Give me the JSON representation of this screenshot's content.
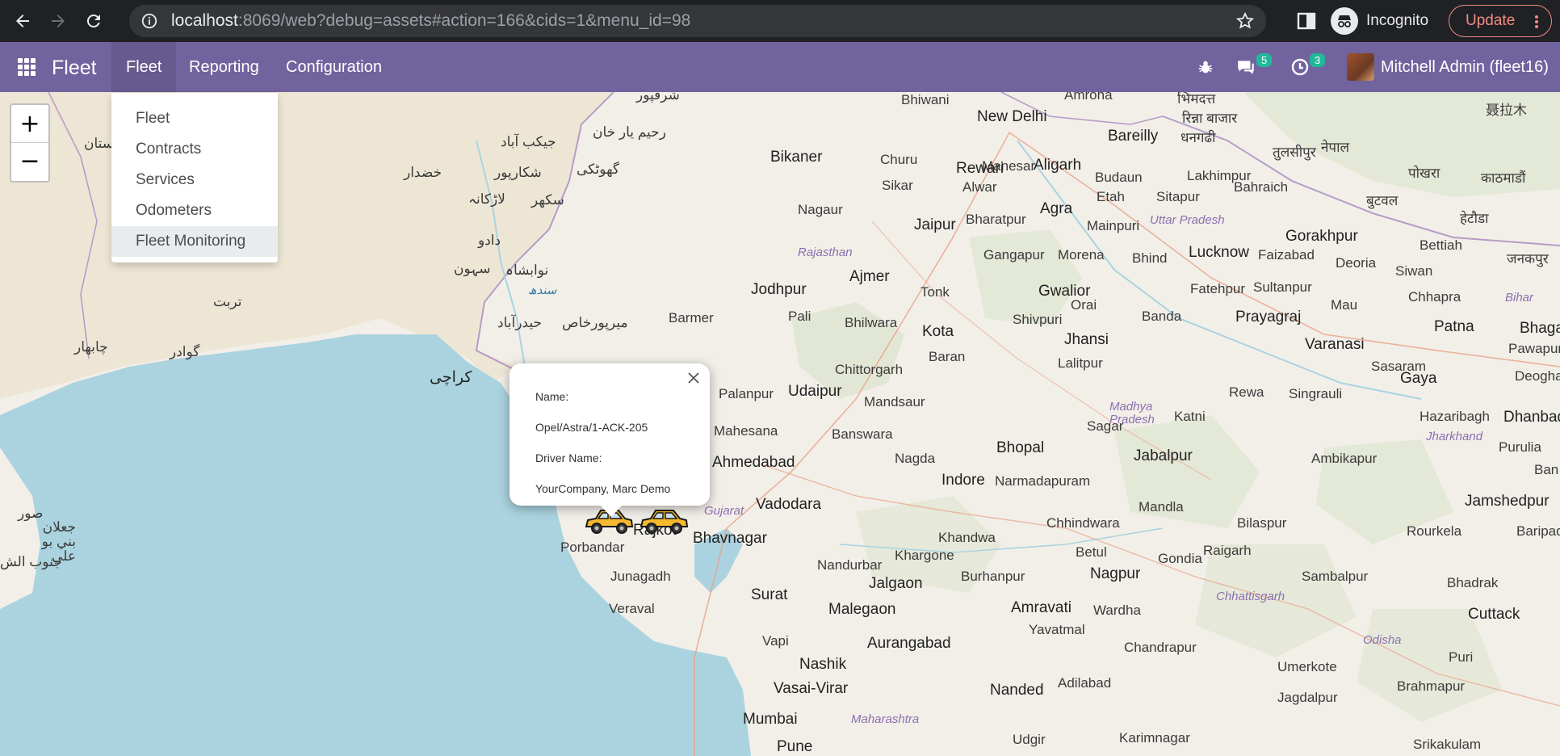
{
  "browser": {
    "url_host": "localhost",
    "url_rest": ":8069/web?debug=assets#action=166&cids=1&menu_id=98",
    "incognito_label": "Incognito",
    "update_label": "Update"
  },
  "navbar": {
    "brand": "Fleet",
    "menus": [
      "Fleet",
      "Reporting",
      "Configuration"
    ],
    "messages_count": "5",
    "activities_count": "3",
    "user_name": "Mitchell Admin (fleet16)"
  },
  "dropdown": {
    "items": [
      "Fleet",
      "Contracts",
      "Services",
      "Odometers",
      "Fleet Monitoring"
    ],
    "selected": "Fleet Monitoring"
  },
  "map": {
    "zoom_in": "+",
    "zoom_out": "−",
    "labels": {
      "new_delhi": "New Delhi",
      "bareilly": "Bareilly",
      "amroha": "Amroha",
      "bhiwani": "Bhiwani",
      "bikaner": "Bikaner",
      "churu": "Churu",
      "rewari": "Rewari",
      "aligarh": "Aligarh",
      "manesar": "Manesar",
      "budaun": "Budaun",
      "sikar": "Sikar",
      "alwar": "Alwar",
      "etah": "Etah",
      "sitapur": "Sitapur",
      "bahraich": "Bahraich",
      "lakhimpur": "Lakhimpur",
      "nagaur": "Nagaur",
      "bharatpur": "Bharatpur",
      "agra": "Agra",
      "mainpuri": "Mainpuri",
      "uttar_pradesh": "Uttar Pradesh",
      "gorakhpur": "Gorakhpur",
      "jaipur": "Jaipur",
      "rajasthan": "Rajasthan",
      "gangapur": "Gangapur",
      "morena": "Morena",
      "bhind": "Bhind",
      "lucknow": "Lucknow",
      "faizabad": "Faizabad",
      "deoria": "Deoria",
      "siwan": "Siwan",
      "bettiah": "Bettiah",
      "ajmer": "Ajmer",
      "jodhpur": "Jodhpur",
      "tonk": "Tonk",
      "gwalior": "Gwalior",
      "fatehpur": "Fatehpur",
      "sultanpur": "Sultanpur",
      "chhapra": "Chhapra",
      "bihar": "Bihar",
      "pali": "Pali",
      "barmer": "Barmer",
      "bhilwara": "Bhilwara",
      "shivpuri": "Shivpuri",
      "orai": "Orai",
      "banda": "Banda",
      "prayagraj": "Prayagraj",
      "mau": "Mau",
      "kota": "Kota",
      "jhansi": "Jhansi",
      "patna": "Patna",
      "bhaga": "Bhaga",
      "varanasi": "Varanasi",
      "pawapuri": "Pawapuri",
      "baran": "Baran",
      "lalitpur": "Lalitpur",
      "chittorgarh": "Chittorgarh",
      "sasaram": "Sasaram",
      "palanpur": "Palanpur",
      "udaipur": "Udaipur",
      "mandsaur": "Mandsaur",
      "rewa": "Rewa",
      "singrauli": "Singrauli",
      "gaya": "Gaya",
      "deogha": "Deogha",
      "madhya_pradesh": "Madhya Pradesh",
      "sagar": "Sagar",
      "katni": "Katni",
      "hazaribagh": "Hazaribagh",
      "dhanbad": "Dhanbad",
      "mahesana": "Mahesana",
      "banswara": "Banswara",
      "jharkhand": "Jharkhand",
      "bhopal": "Bhopal",
      "jabalpur": "Jabalpur",
      "ambikapur": "Ambikapur",
      "purulia": "Purulia",
      "ahmedabad": "Ahmedabad",
      "nagda": "Nagda",
      "indore": "Indore",
      "narmadapuram": "Narmadapuram",
      "ban": "Ban",
      "vadodara": "Vadodara",
      "gujarat": "Gujarat",
      "mandla": "Mandla",
      "jamshedpur": "Jamshedpur",
      "chhindwara": "Chhindwara",
      "bilaspur": "Bilaspur",
      "rourkela": "Rourkela",
      "baripad": "Baripad",
      "rajkot": "Rajkot",
      "bhavnagar": "Bhavnagar",
      "khandwa": "Khandwa",
      "porbandar": "Porbandar",
      "nandurbar": "Nandurbar",
      "khargone": "Khargone",
      "betul": "Betul",
      "raigarh": "Raigarh",
      "gondia": "Gondia",
      "junagadh": "Junagadh",
      "jalgaon": "Jalgaon",
      "burhanpur": "Burhanpur",
      "nagpur": "Nagpur",
      "sambalpur": "Sambalpur",
      "bhadrak": "Bhadrak",
      "surat": "Surat",
      "chhattisgarh": "Chhattisgarh",
      "veraval": "Veraval",
      "malegaon": "Malegaon",
      "amravati": "Amravati",
      "wardha": "Wardha",
      "cuttack": "Cuttack",
      "yavatmal": "Yavatmal",
      "odisha": "Odisha",
      "vapi": "Vapi",
      "aurangabad": "Aurangabad",
      "chandrapur": "Chandrapur",
      "puri": "Puri",
      "nashik": "Nashik",
      "umerkote": "Umerkote",
      "vasai_virar": "Vasai-Virar",
      "adilabad": "Adilabad",
      "brahmapur": "Brahmapur",
      "nanded": "Nanded",
      "jagdalpur": "Jagdalpur",
      "mumbai": "Mumbai",
      "maharashtra": "Maharashtra",
      "pune": "Pune",
      "udgir": "Udgir",
      "karimnagar": "Karimnagar",
      "srikakulam": "Srikakulam",
      "ur_shikarpur": "شکارپور",
      "ur_sukkur": "سکھر",
      "ur_larkana": "لاڑکانہ",
      "ur_dadu": "دادو",
      "ur_nawabshah": "نوابشاہ",
      "ur_sindh": "سندھ",
      "ur_hyderabad": "حیدرآباد",
      "ur_mirpurkhas": "میرپورخاص",
      "ur_karachi": "کراچی",
      "ur_rahimyarkhan": "رحیم یار خان",
      "ur_ghotki": "گھوٹکی",
      "ur_jacobabad": "جیکب آباد",
      "ur_khuzdar": "خضدار",
      "ur_turbat": "تربت",
      "ur_gwadar": "گوادر",
      "ur_chabahar": "چابهار",
      "ur_sehwan": "سہون",
      "ur_shergarh": "شرقپور",
      "hi_bhimdatt": "भिमदत्त",
      "hi_tulsipur": "तुलसीपुर",
      "hi_nepal": "नेपाल",
      "hi_pokhara": "पोखरा",
      "hi_kathmandu": "काठमाडौं",
      "hi_butwal": "बुटवल",
      "hi_hetauda": "हेटौडा",
      "hi_janakpur": "जनकपुर",
      "hi_dhangadhi": "धनगढी",
      "hi_rinna": "रिन्ना बाजार",
      "zh_label": "聂拉木",
      "ar_sur": "صور",
      "ar_jalan": "جعلان بني بو علي",
      "ar_south": "جنوب الش",
      "ar_oman_fragment": "ستان"
    }
  },
  "popup": {
    "name_label": "Name:",
    "name_value": "Opel/Astra/1-ACK-205",
    "driver_label": "Driver Name:",
    "driver_value": "YourCompany, Marc Demo"
  },
  "colors": {
    "navbar": "#71639e",
    "navbar_active": "#665a8f",
    "badge": "#21b799",
    "sea": "#aad3df",
    "land": "#f2efe9"
  }
}
